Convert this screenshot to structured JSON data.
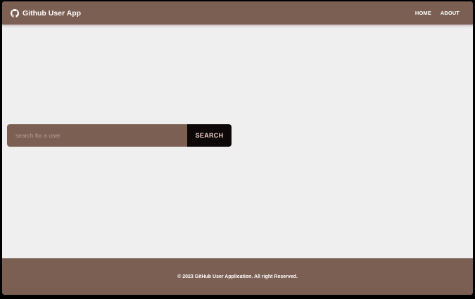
{
  "app": {
    "title": "Github User App",
    "logo_icon": "github-icon"
  },
  "nav": {
    "items": [
      {
        "label": "HOME"
      },
      {
        "label": "ABOUT"
      }
    ]
  },
  "search": {
    "placeholder": "search for a user",
    "value": "",
    "button_label": "SEARCH"
  },
  "footer": {
    "text": "© 2023 GitHub User Application. All right Reserved."
  },
  "colors": {
    "brand": "#7b5f52",
    "background": "#efefef",
    "button": "#0d0707",
    "button_text": "#f4d6cc"
  }
}
